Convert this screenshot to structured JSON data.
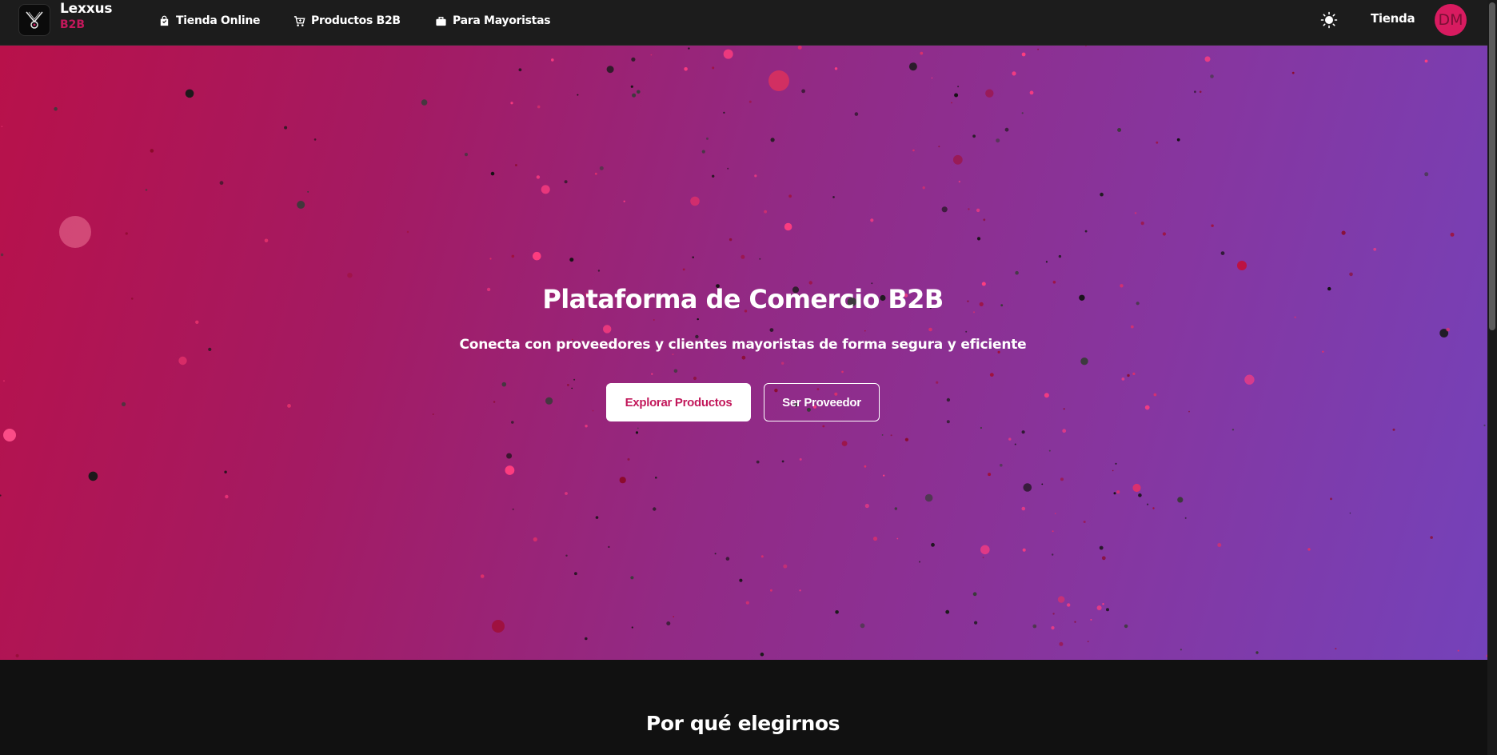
{
  "brand": {
    "name": "Lexxus",
    "sub": "B2B",
    "logo_icon": "scissors-logo-icon"
  },
  "nav": {
    "links": [
      {
        "label": "Tienda Online",
        "icon": "shopping-bag-icon"
      },
      {
        "label": "Productos B2B",
        "icon": "cart-icon"
      },
      {
        "label": "Para Mayoristas",
        "icon": "briefcase-icon"
      }
    ],
    "theme_icon": "sun-icon",
    "shop_label": "Tienda",
    "avatar_initials": "DM"
  },
  "hero": {
    "title": "Plataforma de Comercio B2B",
    "subtitle": "Conecta con proveedores y clientes mayoristas de forma segura y eficiente",
    "primary_button": "Explorar Productos",
    "secondary_button": "Ser Proveedor"
  },
  "features": {
    "title": "Por qué elegirnos"
  },
  "colors": {
    "accent": "#c2185b",
    "avatar": "#d81b60",
    "gradient_start": "#b8114a",
    "gradient_end": "#7442ba",
    "navbar": "#1c1c1c",
    "background": "#111111"
  }
}
